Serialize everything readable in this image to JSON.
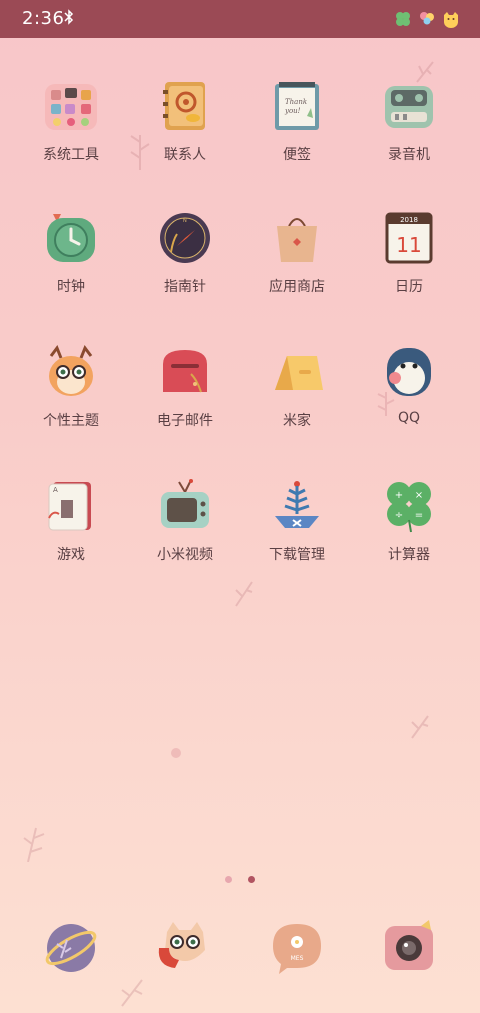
{
  "status_bar": {
    "time": "2:36",
    "icons": [
      "bluetooth-icon",
      "clover-icon",
      "balloons-icon",
      "cat-face-icon"
    ]
  },
  "apps": [
    {
      "label": "系统工具",
      "icon": "toolbox-icon"
    },
    {
      "label": "联系人",
      "icon": "address-book-icon"
    },
    {
      "label": "便签",
      "icon": "notepad-icon"
    },
    {
      "label": "录音机",
      "icon": "recorder-icon"
    },
    {
      "label": "时钟",
      "icon": "clock-icon"
    },
    {
      "label": "指南针",
      "icon": "compass-icon"
    },
    {
      "label": "应用商店",
      "icon": "shopping-bag-icon"
    },
    {
      "label": "日历",
      "icon": "calendar-icon"
    },
    {
      "label": "个性主题",
      "icon": "owl-icon"
    },
    {
      "label": "电子邮件",
      "icon": "mailbox-icon"
    },
    {
      "label": "米家",
      "icon": "tent-icon"
    },
    {
      "label": "QQ",
      "icon": "penguin-icon"
    },
    {
      "label": "游戏",
      "icon": "playing-card-icon"
    },
    {
      "label": "小米视频",
      "icon": "tv-icon"
    },
    {
      "label": "下载管理",
      "icon": "plant-pot-icon"
    },
    {
      "label": "计算器",
      "icon": "clover-calculator-icon"
    }
  ],
  "calendar_icon": {
    "year": "2018",
    "day": "11"
  },
  "notepad_icon_text": "Thank you!",
  "dock": [
    {
      "icon": "planet-browser-icon"
    },
    {
      "icon": "cat-phone-icon"
    },
    {
      "icon": "message-bubble-icon",
      "text": "MES"
    },
    {
      "icon": "camera-icon"
    }
  ],
  "pager": {
    "pages": 2,
    "current": 2
  }
}
